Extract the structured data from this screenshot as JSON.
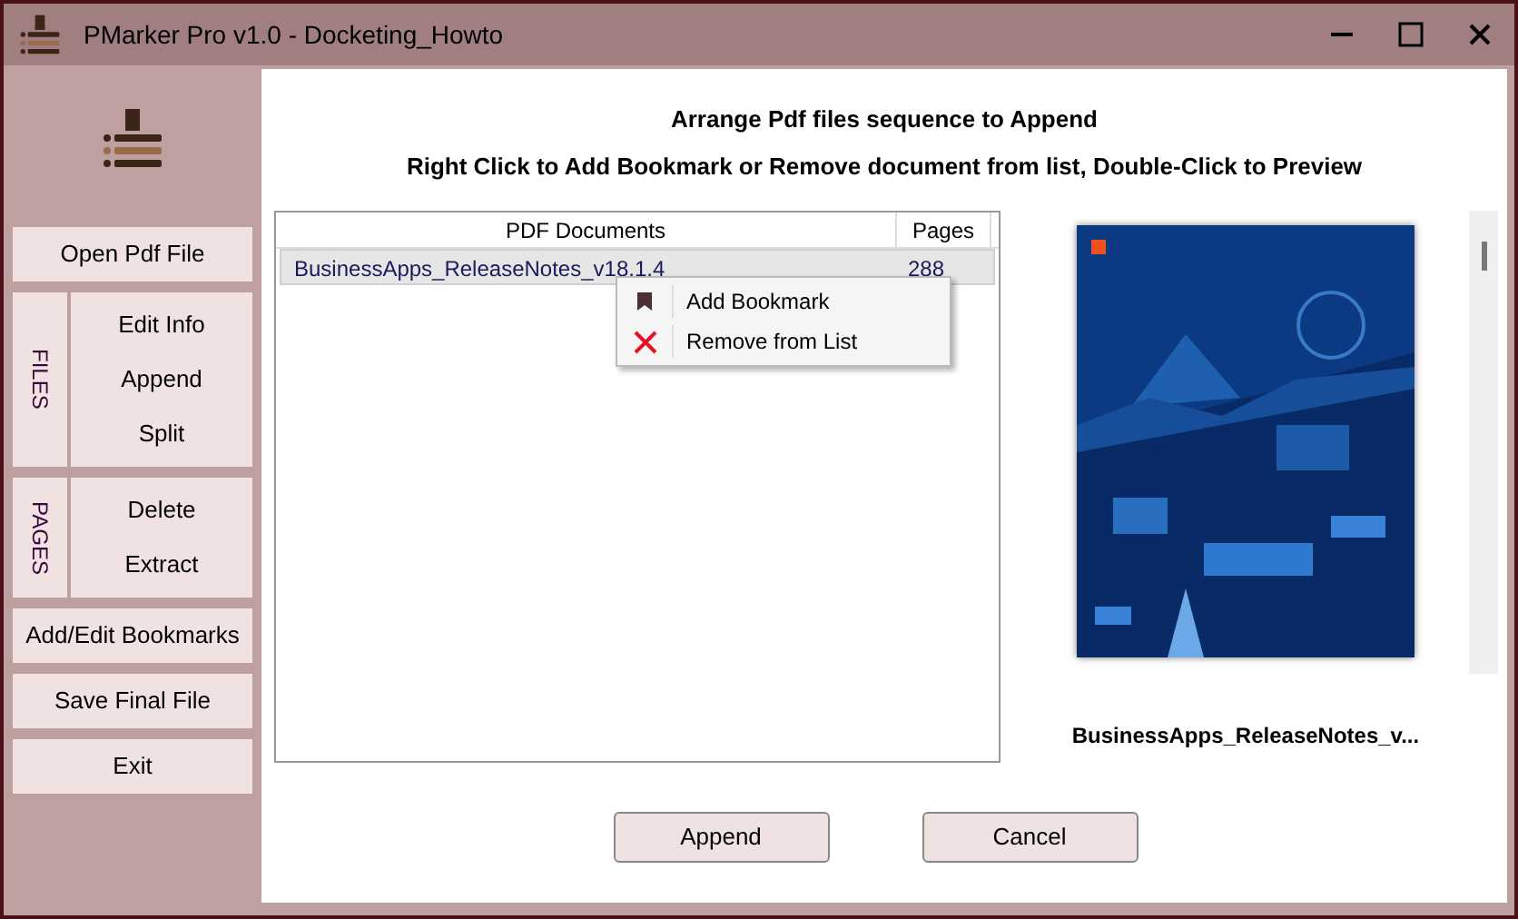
{
  "window": {
    "title": "PMarker Pro v1.0 - Docketing_Howto"
  },
  "sidebar": {
    "top_button": "Open Pdf File",
    "groups": [
      {
        "label": "FILES",
        "buttons": [
          "Edit Info",
          "Append",
          "Split"
        ]
      },
      {
        "label": "PAGES",
        "buttons": [
          "Delete",
          "Extract"
        ]
      }
    ],
    "bottom_buttons": [
      "Add/Edit Bookmarks",
      "Save Final File",
      "Exit"
    ]
  },
  "header": {
    "title": "Arrange Pdf files sequence to Append",
    "subtitle": "Right Click to Add Bookmark or Remove document from list, Double-Click to Preview"
  },
  "table": {
    "columns": [
      "PDF Documents",
      "Pages"
    ],
    "rows": [
      {
        "name": "BusinessApps_ReleaseNotes_v18.1.4",
        "pages": "288",
        "selected": true
      }
    ]
  },
  "context_menu": {
    "items": [
      {
        "kind": "bookmark",
        "label": "Add Bookmark"
      },
      {
        "kind": "remove",
        "label": "Remove from List"
      }
    ]
  },
  "preview": {
    "kind": "picture",
    "caption": "BusinessApps_ReleaseNotes_v..."
  },
  "buttons": [
    "Append",
    "Cancel"
  ]
}
